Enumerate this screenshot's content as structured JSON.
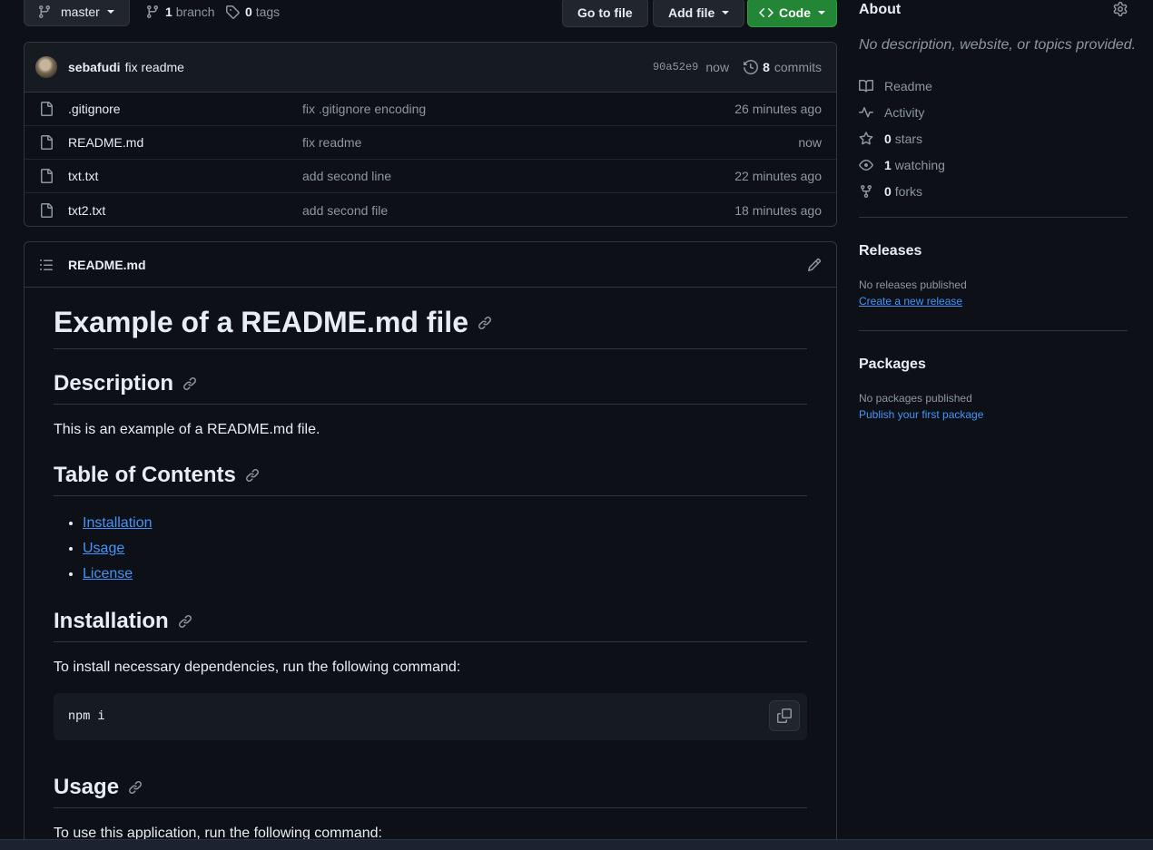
{
  "toolbar": {
    "branch": "master",
    "branch_count": "1",
    "branch_label": "branch",
    "tag_count": "0",
    "tag_label": "tags",
    "go_to_file": "Go to file",
    "add_file": "Add file",
    "code": "Code"
  },
  "commit": {
    "author": "sebafudi",
    "message": "fix readme",
    "sha": "90a52e9",
    "time": "now",
    "count": "8",
    "count_label": "commits"
  },
  "files": [
    {
      "name": ".gitignore",
      "message": "fix .gitignore encoding",
      "time": "26 minutes ago"
    },
    {
      "name": "README.md",
      "message": "fix readme",
      "time": "now"
    },
    {
      "name": "txt.txt",
      "message": "add second line",
      "time": "22 minutes ago"
    },
    {
      "name": "txt2.txt",
      "message": "add second file",
      "time": "18 minutes ago"
    }
  ],
  "readme": {
    "filename": "README.md",
    "h1": "Example of a README.md file",
    "description_heading": "Description",
    "description_text": "This is an example of a README.md file.",
    "toc_heading": "Table of Contents",
    "toc": [
      "Installation",
      "Usage",
      "License"
    ],
    "installation_heading": "Installation",
    "installation_text": "To install necessary dependencies, run the following command:",
    "install_command": "npm i",
    "usage_heading": "Usage",
    "usage_text": "To use this application, run the following command:"
  },
  "sidebar": {
    "about_title": "About",
    "about_desc": "No description, website, or topics provided.",
    "readme": "Readme",
    "activity": "Activity",
    "stars_count": "0",
    "stars_label": "stars",
    "watching_count": "1",
    "watching_label": "watching",
    "forks_count": "0",
    "forks_label": "forks",
    "releases_title": "Releases",
    "releases_note": "No releases published",
    "releases_link": "Create a new release",
    "packages_title": "Packages",
    "packages_note": "No packages published",
    "packages_link": "Publish your first package"
  },
  "colors": {
    "background": "#0d1117",
    "accent_link": "#4493f8",
    "code_button": "#238636",
    "border": "#30363d"
  }
}
